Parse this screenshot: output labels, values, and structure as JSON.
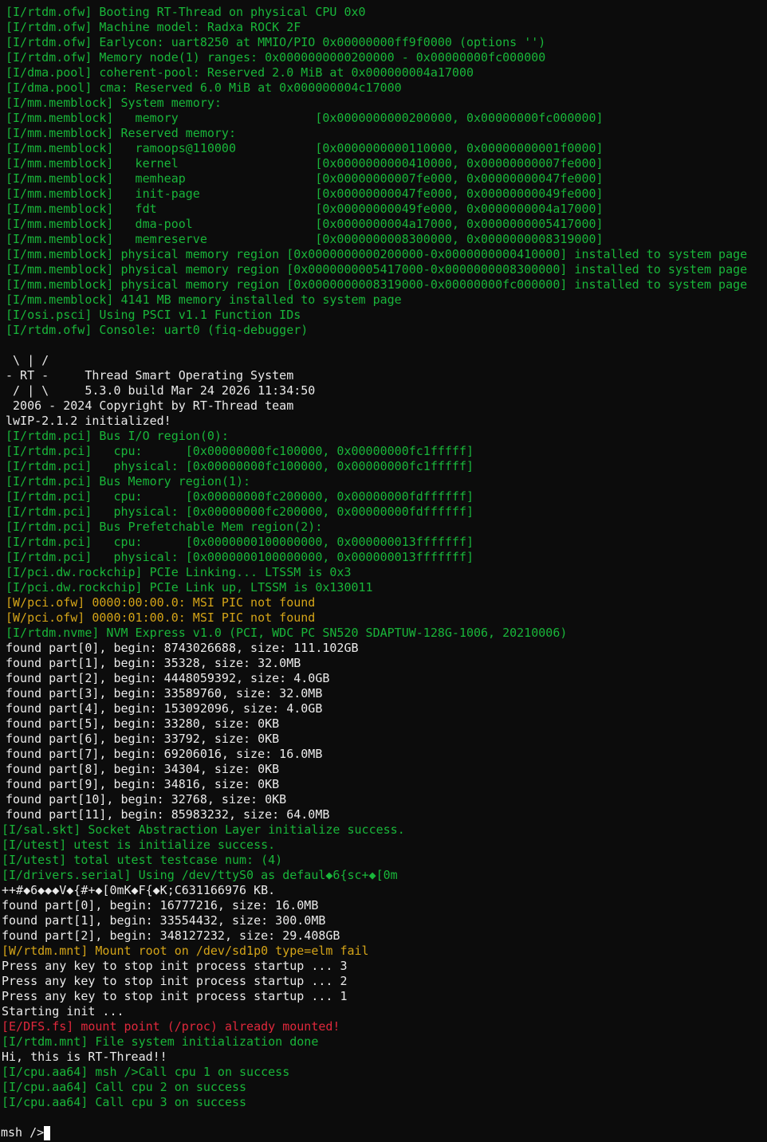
{
  "terminal": {
    "colors": {
      "background": "#0c0c0c",
      "info": "#19b63a",
      "warn": "#d4a418",
      "error": "#e0283c",
      "plain": "#eaeaea"
    },
    "lines": [
      {
        "k": "info",
        "text": "[I/rtdm.ofw] Booting RT-Thread on physical CPU 0x0"
      },
      {
        "k": "info",
        "text": "[I/rtdm.ofw] Machine model: Radxa ROCK 2F"
      },
      {
        "k": "info",
        "text": "[I/rtdm.ofw] Earlycon: uart8250 at MMIO/PIO 0x00000000ff9f0000 (options '')"
      },
      {
        "k": "info",
        "text": "[I/rtdm.ofw] Memory node(1) ranges: 0x0000000000200000 - 0x00000000fc000000"
      },
      {
        "k": "info",
        "text": "[I/dma.pool] coherent-pool: Reserved 2.0 MiB at 0x000000004a17000"
      },
      {
        "k": "info",
        "text": "[I/dma.pool] cma: Reserved 6.0 MiB at 0x000000004c17000"
      },
      {
        "k": "info",
        "text": "[I/mm.memblock] System memory:"
      },
      {
        "k": "info",
        "text": "[I/mm.memblock]   memory                   [0x0000000000200000, 0x00000000fc000000]"
      },
      {
        "k": "info",
        "text": "[I/mm.memblock] Reserved memory:"
      },
      {
        "k": "info",
        "text": "[I/mm.memblock]   ramoops@110000           [0x0000000000110000, 0x00000000001f0000]"
      },
      {
        "k": "info",
        "text": "[I/mm.memblock]   kernel                   [0x0000000000410000, 0x00000000007fe000]"
      },
      {
        "k": "info",
        "text": "[I/mm.memblock]   memheap                  [0x00000000007fe000, 0x00000000047fe000]"
      },
      {
        "k": "info",
        "text": "[I/mm.memblock]   init-page                [0x00000000047fe000, 0x00000000049fe000]"
      },
      {
        "k": "info",
        "text": "[I/mm.memblock]   fdt                      [0x00000000049fe000, 0x0000000004a17000]"
      },
      {
        "k": "info",
        "text": "[I/mm.memblock]   dma-pool                 [0x0000000004a17000, 0x0000000005417000]"
      },
      {
        "k": "info",
        "text": "[I/mm.memblock]   memreserve               [0x0000000008300000, 0x0000000008319000]"
      },
      {
        "k": "info",
        "text": "[I/mm.memblock] physical memory region [0x0000000000200000-0x0000000000410000] installed to system page"
      },
      {
        "k": "info",
        "text": "[I/mm.memblock] physical memory region [0x0000000005417000-0x0000000008300000] installed to system page"
      },
      {
        "k": "info",
        "text": "[I/mm.memblock] physical memory region [0x0000000008319000-0x00000000fc000000] installed to system page"
      },
      {
        "k": "info",
        "text": "[I/mm.memblock] 4141 MB memory installed to system page"
      },
      {
        "k": "info",
        "text": "[I/osi.psci] Using PSCI v1.1 Function IDs"
      },
      {
        "k": "info",
        "text": "[I/rtdm.ofw] Console: uart0 (fiq-debugger)"
      },
      {
        "k": "plain",
        "text": ""
      },
      {
        "k": "plain",
        "text": " \\ | /"
      },
      {
        "k": "plain",
        "text": "- RT -     Thread Smart Operating System"
      },
      {
        "k": "plain",
        "text": " / | \\     5.3.0 build Mar 24 2026 11:34:50"
      },
      {
        "k": "plain",
        "text": " 2006 - 2024 Copyright by RT-Thread team"
      },
      {
        "k": "plain",
        "text": "lwIP-2.1.2 initialized!"
      },
      {
        "k": "info",
        "text": "[I/rtdm.pci] Bus I/O region(0):"
      },
      {
        "k": "info",
        "text": "[I/rtdm.pci]   cpu:      [0x00000000fc100000, 0x00000000fc1fffff]"
      },
      {
        "k": "info",
        "text": "[I/rtdm.pci]   physical: [0x00000000fc100000, 0x00000000fc1fffff]"
      },
      {
        "k": "info",
        "text": "[I/rtdm.pci] Bus Memory region(1):"
      },
      {
        "k": "info",
        "text": "[I/rtdm.pci]   cpu:      [0x00000000fc200000, 0x00000000fdffffff]"
      },
      {
        "k": "info",
        "text": "[I/rtdm.pci]   physical: [0x00000000fc200000, 0x00000000fdffffff]"
      },
      {
        "k": "info",
        "text": "[I/rtdm.pci] Bus Prefetchable Mem region(2):"
      },
      {
        "k": "info",
        "text": "[I/rtdm.pci]   cpu:      [0x0000000100000000, 0x000000013fffffff]"
      },
      {
        "k": "info",
        "text": "[I/rtdm.pci]   physical: [0x0000000100000000, 0x000000013fffffff]"
      },
      {
        "k": "info",
        "text": "[I/pci.dw.rockchip] PCIe Linking... LTSSM is 0x3"
      },
      {
        "k": "info",
        "text": "[I/pci.dw.rockchip] PCIe Link up, LTSSM is 0x130011"
      },
      {
        "k": "warn",
        "text": "[W/pci.ofw] 0000:00:00.0: MSI PIC not found"
      },
      {
        "k": "warn",
        "text": "[W/pci.ofw] 0000:01:00.0: MSI PIC not found"
      },
      {
        "k": "info",
        "text": "[I/rtdm.nvme] NVM Express v1.0 (PCI, WDC PC SN520 SDAPTUW-128G-1006, 20210006)"
      },
      {
        "k": "plain",
        "text": "found part[0], begin: 8743026688, size: 111.102GB"
      },
      {
        "k": "plain",
        "text": "found part[1], begin: 35328, size: 32.0MB"
      },
      {
        "k": "plain",
        "text": "found part[2], begin: 4448059392, size: 4.0GB"
      },
      {
        "k": "plain",
        "text": "found part[3], begin: 33589760, size: 32.0MB"
      },
      {
        "k": "plain",
        "text": "found part[4], begin: 153092096, size: 4.0GB"
      },
      {
        "k": "plain",
        "text": "found part[5], begin: 33280, size: 0KB"
      },
      {
        "k": "plain",
        "text": "found part[6], begin: 33792, size: 0KB"
      },
      {
        "k": "plain",
        "text": "found part[7], begin: 69206016, size: 16.0MB"
      },
      {
        "k": "plain",
        "text": "found part[8], begin: 34304, size: 0KB"
      },
      {
        "k": "plain",
        "text": "found part[9], begin: 34816, size: 0KB"
      },
      {
        "k": "plain",
        "text": "found part[10], begin: 32768, size: 0KB"
      },
      {
        "k": "plain",
        "text": "found part[11], begin: 85983232, size: 64.0MB"
      },
      {
        "k": "info",
        "text": "[I/sal.skt] Socket Abstraction Layer initialize success."
      },
      {
        "k": "info",
        "text": "[I/utest] utest is initialize success."
      },
      {
        "k": "info",
        "text": "[I/utest] total utest testcase num: (4)"
      },
      {
        "k": "info",
        "text": "[I/drivers.serial] Using /dev/ttyS0 as defaul◆6{sc+◆[0m"
      },
      {
        "k": "plain",
        "text": "++#◆6◆◆◆V◆{#+◆[0mK◆F{◆K;C631166976 KB."
      },
      {
        "k": "plain",
        "text": "found part[0], begin: 16777216, size: 16.0MB"
      },
      {
        "k": "plain",
        "text": "found part[1], begin: 33554432, size: 300.0MB"
      },
      {
        "k": "plain",
        "text": "found part[2], begin: 348127232, size: 29.408GB"
      },
      {
        "k": "warn",
        "text": "[W/rtdm.mnt] Mount root on /dev/sd1p0 type=elm fail"
      },
      {
        "k": "plain",
        "text": "Press any key to stop init process startup ... 3"
      },
      {
        "k": "plain",
        "text": "Press any key to stop init process startup ... 2"
      },
      {
        "k": "plain",
        "text": "Press any key to stop init process startup ... 1"
      },
      {
        "k": "plain",
        "text": "Starting init ..."
      },
      {
        "k": "err",
        "text": "[E/DFS.fs] mount point (/proc) already mounted!"
      },
      {
        "k": "info",
        "text": "[I/rtdm.mnt] File system initialization done"
      },
      {
        "k": "plain",
        "text": "Hi, this is RT-Thread!!"
      },
      {
        "k": "info",
        "text": "[I/cpu.aa64] msh />Call cpu 1 on success"
      },
      {
        "k": "info",
        "text": "[I/cpu.aa64] Call cpu 2 on success"
      },
      {
        "k": "info",
        "text": "[I/cpu.aa64] Call cpu 3 on success"
      },
      {
        "k": "plain",
        "text": ""
      },
      {
        "k": "prompt",
        "text": "msh />"
      }
    ]
  }
}
